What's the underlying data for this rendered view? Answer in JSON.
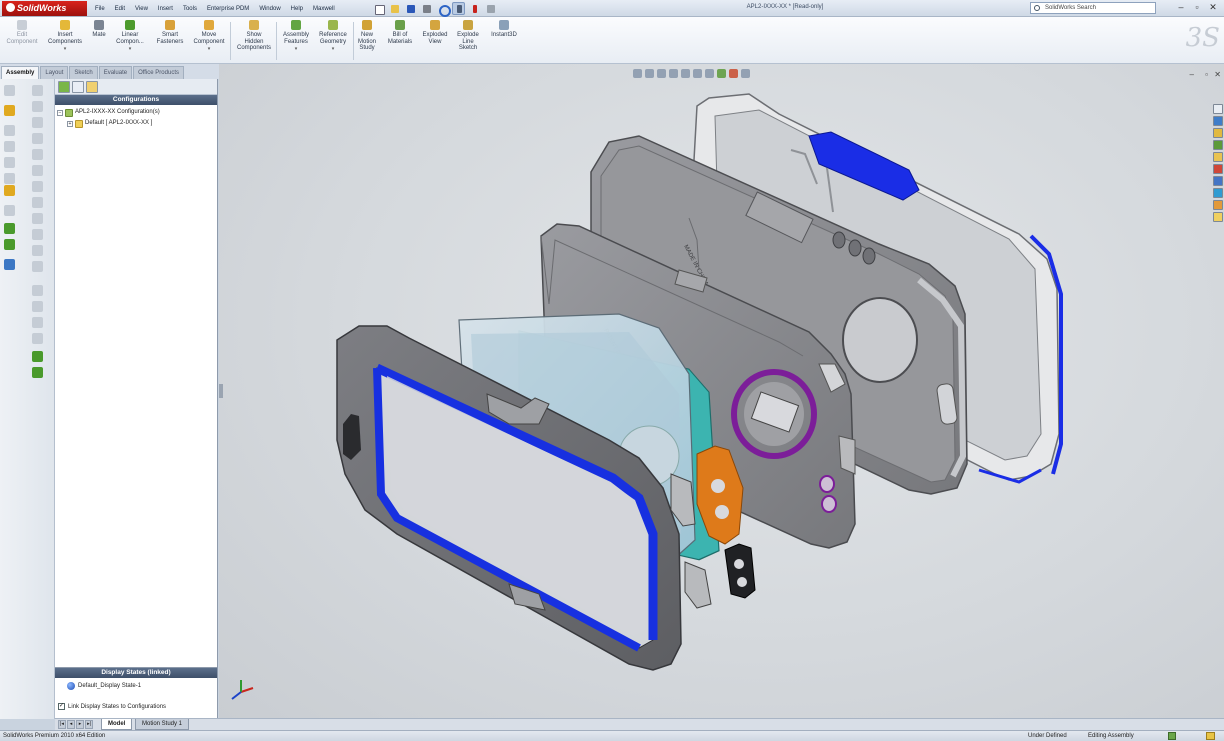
{
  "app": {
    "name": "SolidWorks",
    "window_title": "APL2-IXXX-XX * [Read-only]",
    "search_placeholder": "SolidWorks Search"
  },
  "menu": [
    "File",
    "Edit",
    "View",
    "Insert",
    "Tools",
    "Enterprise PDM",
    "Window",
    "Help",
    "Maxwell"
  ],
  "commands": [
    {
      "label": "Edit\nComponent",
      "enabled": false
    },
    {
      "label": "Insert\nComponents",
      "enabled": true
    },
    {
      "label": "Mate",
      "enabled": true
    },
    {
      "label": "Linear\nCompon...",
      "enabled": true
    },
    {
      "label": "Smart\nFasteners",
      "enabled": true
    },
    {
      "label": "Move\nComponent",
      "enabled": true
    },
    {
      "label": "Show\nHidden\nComponents",
      "enabled": true
    },
    {
      "label": "Assembly\nFeatures",
      "enabled": true
    },
    {
      "label": "Reference\nGeometry",
      "enabled": true
    },
    {
      "label": "New\nMotion\nStudy",
      "enabled": true
    },
    {
      "label": "Bill of\nMaterials",
      "enabled": true
    },
    {
      "label": "Exploded\nView",
      "enabled": true
    },
    {
      "label": "Explode\nLine\nSketch",
      "enabled": true
    },
    {
      "label": "Instant3D",
      "enabled": true
    }
  ],
  "tabs": [
    "Assembly",
    "Layout",
    "Sketch",
    "Evaluate",
    "Office Products"
  ],
  "configurations": {
    "header": "Configurations",
    "root": "APL2-IXXX-XX Configuration(s)",
    "default": "Default [ APL2-IXXX-XX ]"
  },
  "display_states": {
    "header": "Display States (linked)",
    "item": "Default_Display State-1",
    "link_checkbox": "Link Display States to Configurations"
  },
  "bottom_tabs": [
    "Model",
    "Motion Study 1"
  ],
  "status": {
    "edition": "SolidWorks Premium 2010 x64 Edition",
    "units": "Under Defined",
    "mode": "Editing Assembly"
  },
  "colors": {
    "accent_blue": "#1730e0",
    "case_gray": "#8d8e92",
    "teal": "#3cb4b0",
    "orange": "#de7a1a",
    "purple": "#7c1e99"
  }
}
